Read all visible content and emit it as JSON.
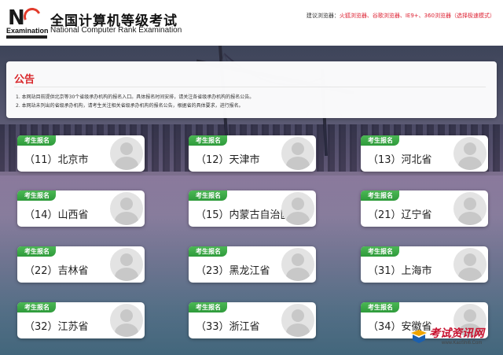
{
  "header": {
    "logo_letters": "NCR",
    "logo_word": "Examination",
    "title": "全国计算机等级考试",
    "subtitle": "National Computer Rank Examination",
    "browser_tip_label": "建议浏览器：",
    "browser_tip_list": "火狐浏览器、谷歌浏览器、IE9+、360浏览器（选择极速模式）",
    "colors": {
      "accent_red": "#d9262a",
      "tag_green": "#3aa848"
    }
  },
  "notice": {
    "title": "公告",
    "items": [
      "1. 本网站目前提供北京等30个省级承办机构的报名入口。具体报名时间安排，请关注各省级承办机构的报名公告。",
      "2. 本网站未列出的省级承办机构，请考生关注相关省级承办机构的报名公告，根据省的具体要求，进行报名。"
    ]
  },
  "card_tag": "考生报名",
  "provinces": [
    {
      "label": "（11）北京市"
    },
    {
      "label": "（12）天津市"
    },
    {
      "label": "（13）河北省"
    },
    {
      "label": "（14）山西省"
    },
    {
      "label": "（15）内蒙古自治区"
    },
    {
      "label": "（21）辽宁省"
    },
    {
      "label": "（22）吉林省"
    },
    {
      "label": "（23）黑龙江省"
    },
    {
      "label": "（31）上海市"
    },
    {
      "label": "（32）江苏省"
    },
    {
      "label": "（33）浙江省"
    },
    {
      "label": "（34）安徽省"
    }
  ],
  "watermark": {
    "title": "考试资讯网",
    "url": "www.KaoShi6.Com"
  },
  "icons": {
    "avatar": "user-avatar-icon"
  }
}
